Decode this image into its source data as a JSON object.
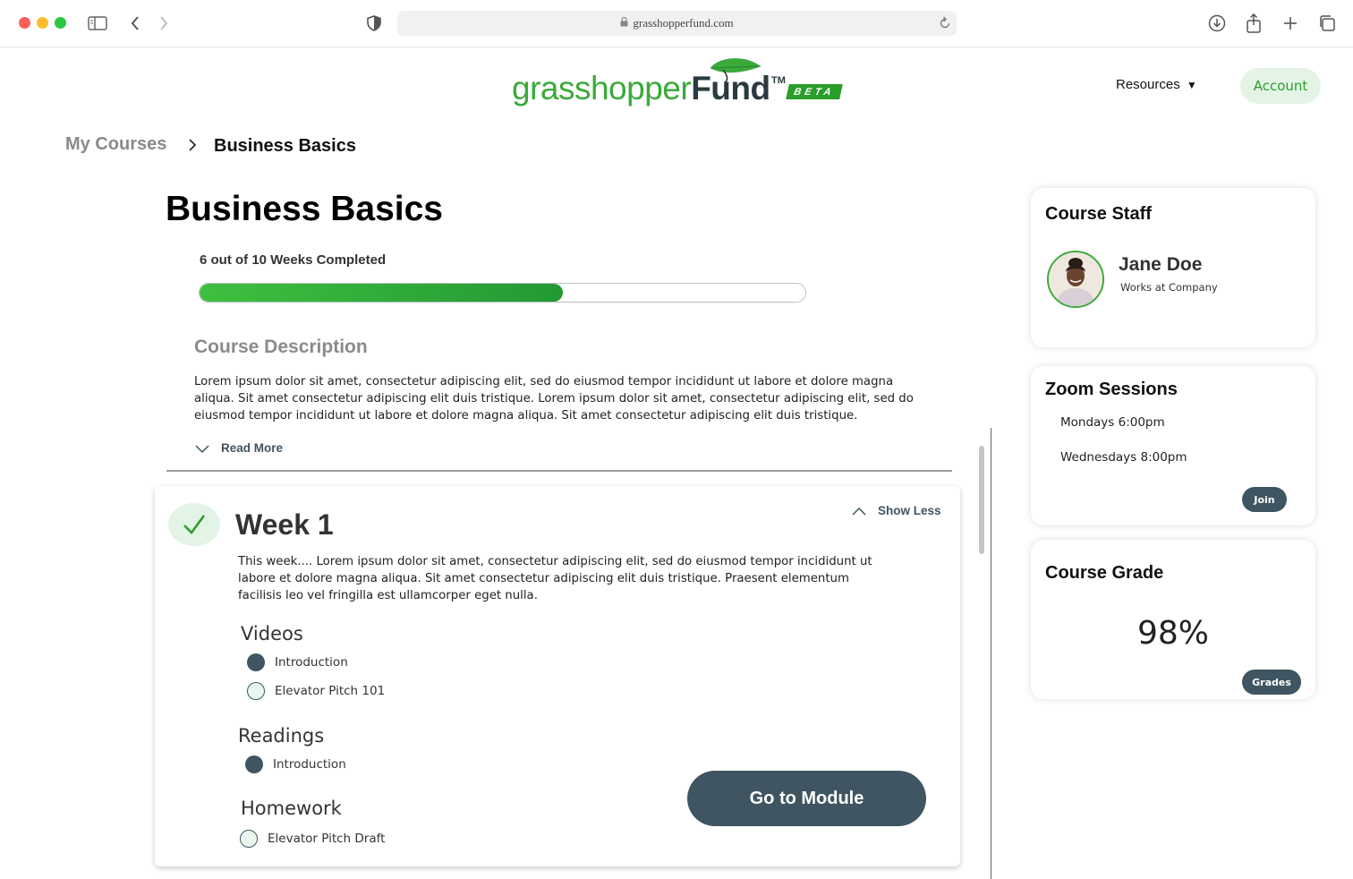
{
  "browser": {
    "url": "grasshopperfund.com"
  },
  "brand": {
    "logo_part1": "grasshopper",
    "logo_part2": "Fund",
    "trademark": "TM",
    "badge": "BETA",
    "green": "#3aaa3a",
    "dark": "#3f5561",
    "light_green": "#e3f4e6"
  },
  "nav": {
    "resources": "Resources",
    "account": "Account"
  },
  "breadcrumb": {
    "parent": "My Courses",
    "current": "Business Basics"
  },
  "course": {
    "title": "Business Basics",
    "progress_label": "6 out of 10 Weeks Completed",
    "progress_completed": 6,
    "progress_total": 10,
    "description_title": "Course Description",
    "description": "Lorem ipsum dolor sit amet, consectetur adipiscing elit, sed do eiusmod tempor incididunt ut labore et dolore magna aliqua. Sit amet consectetur adipiscing elit duis tristique. Lorem ipsum dolor sit amet, consectetur adipiscing elit, sed do eiusmod tempor incididunt ut labore et dolore magna aliqua. Sit amet consectetur adipiscing elit duis tristique.",
    "read_more": "Read More"
  },
  "week": {
    "title": "Week 1",
    "toggle": "Show Less",
    "text": "This week.... Lorem ipsum dolor sit amet, consectetur adipiscing elit, sed do eiusmod tempor incididunt ut labore et dolore magna aliqua. Sit amet consectetur adipiscing elit duis tristique.  Praesent elementum facilisis leo vel fringilla est ullamcorper eget nulla.",
    "videos_heading": "Videos",
    "videos": [
      {
        "label": "Introduction",
        "done": true
      },
      {
        "label": "Elevator Pitch 101",
        "done": false
      }
    ],
    "readings_heading": "Readings",
    "readings": [
      {
        "label": "Introduction",
        "done": true
      }
    ],
    "homework_heading": "Homework",
    "homework": [
      {
        "label": "Elevator Pitch Draft",
        "done": false
      }
    ],
    "cta": "Go to Module"
  },
  "staff": {
    "title": "Course Staff",
    "name": "Jane Doe",
    "role": "Works at Company"
  },
  "zoom": {
    "title": "Zoom Sessions",
    "sessions": [
      "Mondays 6:00pm",
      "Wednesdays 8:00pm"
    ],
    "join": "Join"
  },
  "grade": {
    "title": "Course Grade",
    "value": "98%",
    "button": "Grades"
  }
}
